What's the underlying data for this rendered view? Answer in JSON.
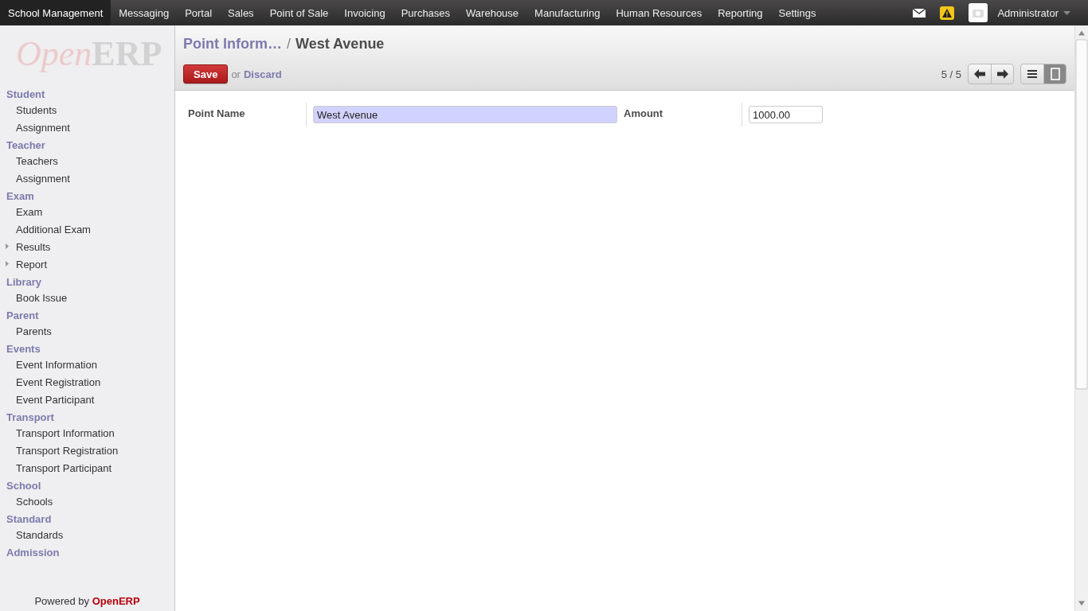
{
  "top_menu": [
    {
      "label": "School Management",
      "selected": true
    },
    {
      "label": "Messaging",
      "selected": false
    },
    {
      "label": "Portal",
      "selected": false
    },
    {
      "label": "Sales",
      "selected": false
    },
    {
      "label": "Point of Sale",
      "selected": false
    },
    {
      "label": "Invoicing",
      "selected": false
    },
    {
      "label": "Purchases",
      "selected": false
    },
    {
      "label": "Warehouse",
      "selected": false
    },
    {
      "label": "Manufacturing",
      "selected": false
    },
    {
      "label": "Human Resources",
      "selected": false
    },
    {
      "label": "Reporting",
      "selected": false
    },
    {
      "label": "Settings",
      "selected": false
    }
  ],
  "user": {
    "name": "Administrator"
  },
  "logo": {
    "first": "Open",
    "second": "ERP"
  },
  "sidebar": {
    "sections": [
      {
        "title": "Student",
        "items": [
          {
            "label": "Students",
            "expandable": false
          },
          {
            "label": "Assignment",
            "expandable": false
          }
        ]
      },
      {
        "title": "Teacher",
        "items": [
          {
            "label": "Teachers",
            "expandable": false
          },
          {
            "label": "Assignment",
            "expandable": false
          }
        ]
      },
      {
        "title": "Exam",
        "items": [
          {
            "label": "Exam",
            "expandable": false
          },
          {
            "label": "Additional Exam",
            "expandable": false
          },
          {
            "label": "Results",
            "expandable": true
          },
          {
            "label": "Report",
            "expandable": true
          }
        ]
      },
      {
        "title": "Library",
        "items": [
          {
            "label": "Book Issue",
            "expandable": false
          }
        ]
      },
      {
        "title": "Parent",
        "items": [
          {
            "label": "Parents",
            "expandable": false
          }
        ]
      },
      {
        "title": "Events",
        "items": [
          {
            "label": "Event Information",
            "expandable": false
          },
          {
            "label": "Event Registration",
            "expandable": false
          },
          {
            "label": "Event Participant",
            "expandable": false
          }
        ]
      },
      {
        "title": "Transport",
        "items": [
          {
            "label": "Transport Information",
            "expandable": false
          },
          {
            "label": "Transport Registration",
            "expandable": false
          },
          {
            "label": "Transport Participant",
            "expandable": false
          }
        ]
      },
      {
        "title": "School",
        "items": [
          {
            "label": "Schools",
            "expandable": false
          }
        ]
      },
      {
        "title": "Standard",
        "items": [
          {
            "label": "Standards",
            "expandable": false
          }
        ]
      },
      {
        "title": "Admission"
      }
    ],
    "footer_text": "Powered by",
    "footer_brand": "OpenERP"
  },
  "breadcrumb": {
    "parent": "Point Inform…",
    "separator": "/",
    "current": "West Avenue"
  },
  "actions": {
    "save": "Save",
    "or": "or",
    "discard": "Discard"
  },
  "pager": {
    "text": "5 / 5"
  },
  "views": [
    {
      "kind": "list",
      "selected": false
    },
    {
      "kind": "form",
      "selected": true
    }
  ],
  "form": {
    "fields": [
      {
        "label": "Point Name",
        "value": "West Avenue",
        "required": true
      },
      {
        "label": "Amount",
        "value": "1000.00",
        "required": false
      }
    ]
  }
}
